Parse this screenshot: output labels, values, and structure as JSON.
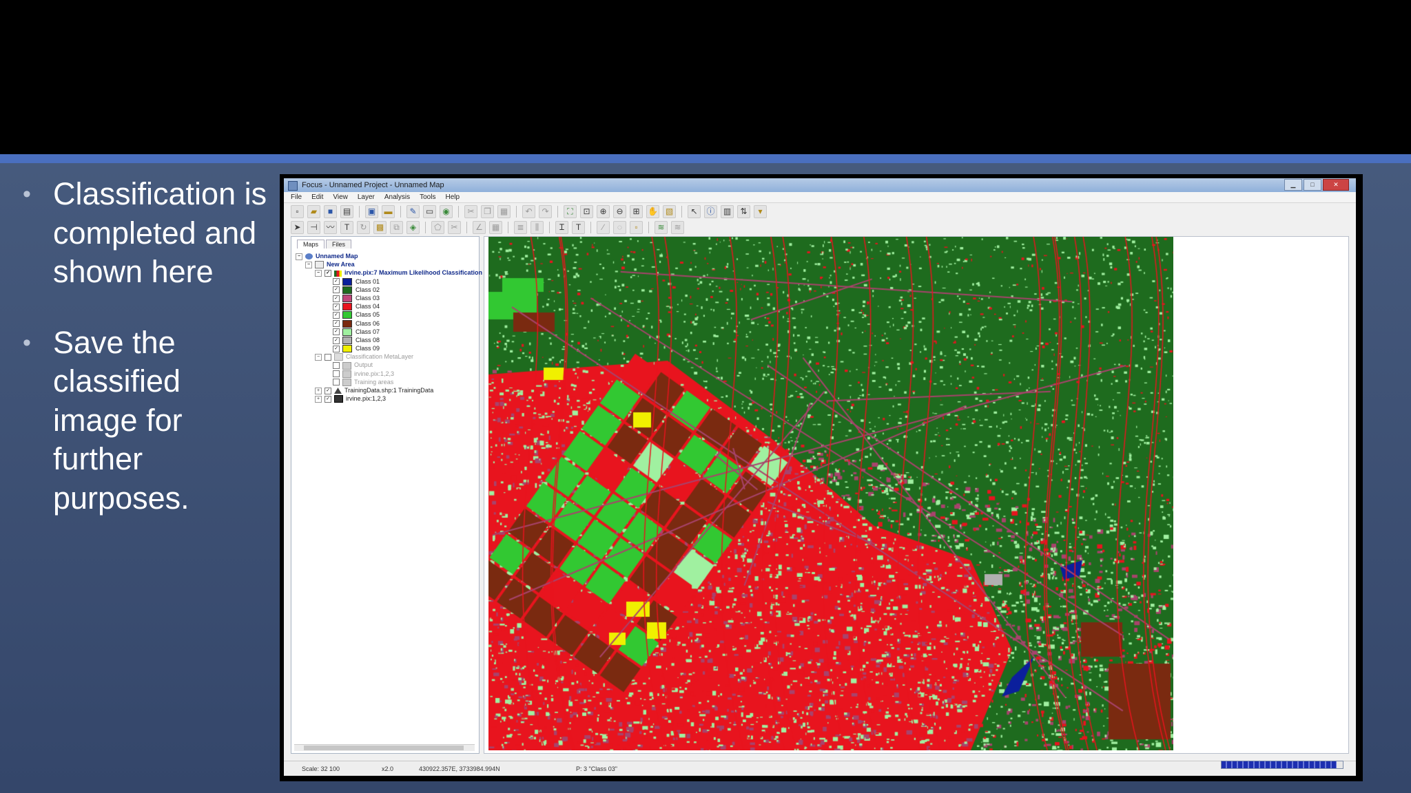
{
  "slide": {
    "bullets": [
      "Classification is completed and shown here",
      "Save the classified image for further purposes."
    ]
  },
  "window": {
    "title": "Focus - Unnamed Project - Unnamed Map",
    "menu": [
      "File",
      "Edit",
      "View",
      "Layer",
      "Analysis",
      "Tools",
      "Help"
    ]
  },
  "toc": {
    "tabs": [
      "Maps",
      "Files"
    ],
    "tree": {
      "root": "Unnamed Map",
      "area": "New Area",
      "classification_layer": "irvine.pix:7 Maximum Likelihood Classification",
      "classes": [
        {
          "label": "Class 01",
          "color": "#0b1f9c"
        },
        {
          "label": "Class 02",
          "color": "#1e6b1e"
        },
        {
          "label": "Class 03",
          "color": "#c0467a"
        },
        {
          "label": "Class 04",
          "color": "#e8141e"
        },
        {
          "label": "Class 05",
          "color": "#32c832"
        },
        {
          "label": "Class 06",
          "color": "#7a2a10"
        },
        {
          "label": "Class 07",
          "color": "#a0f0a0"
        },
        {
          "label": "Class 08",
          "color": "#b0b0b0"
        },
        {
          "label": "Class 09",
          "color": "#f0f000"
        }
      ],
      "metalayer": "Classification MetaLayer",
      "meta_items": [
        "Output",
        "irvine.pix:1,2,3",
        "Training areas"
      ],
      "training_layer": "TrainingData.shp:1 TrainingData",
      "raster_layer": "irvine.pix:1,2,3"
    }
  },
  "map": {
    "class_colors": {
      "forest": "#1e6b1e",
      "urban": "#e8141e",
      "mauve": "#a8436c",
      "light_green": "#a0f0a0",
      "bright_green": "#32c832",
      "brown": "#7a2a10",
      "water": "#0b1f9c",
      "yellow": "#f0f000",
      "gray": "#b0b0b0"
    }
  },
  "status": {
    "scale": "Scale: 32 100",
    "zoom": "x2.0",
    "coords": "430922.357E, 3733984.994N",
    "pixel": "P: 3 \"Class 03\"",
    "progress": 0.95
  }
}
